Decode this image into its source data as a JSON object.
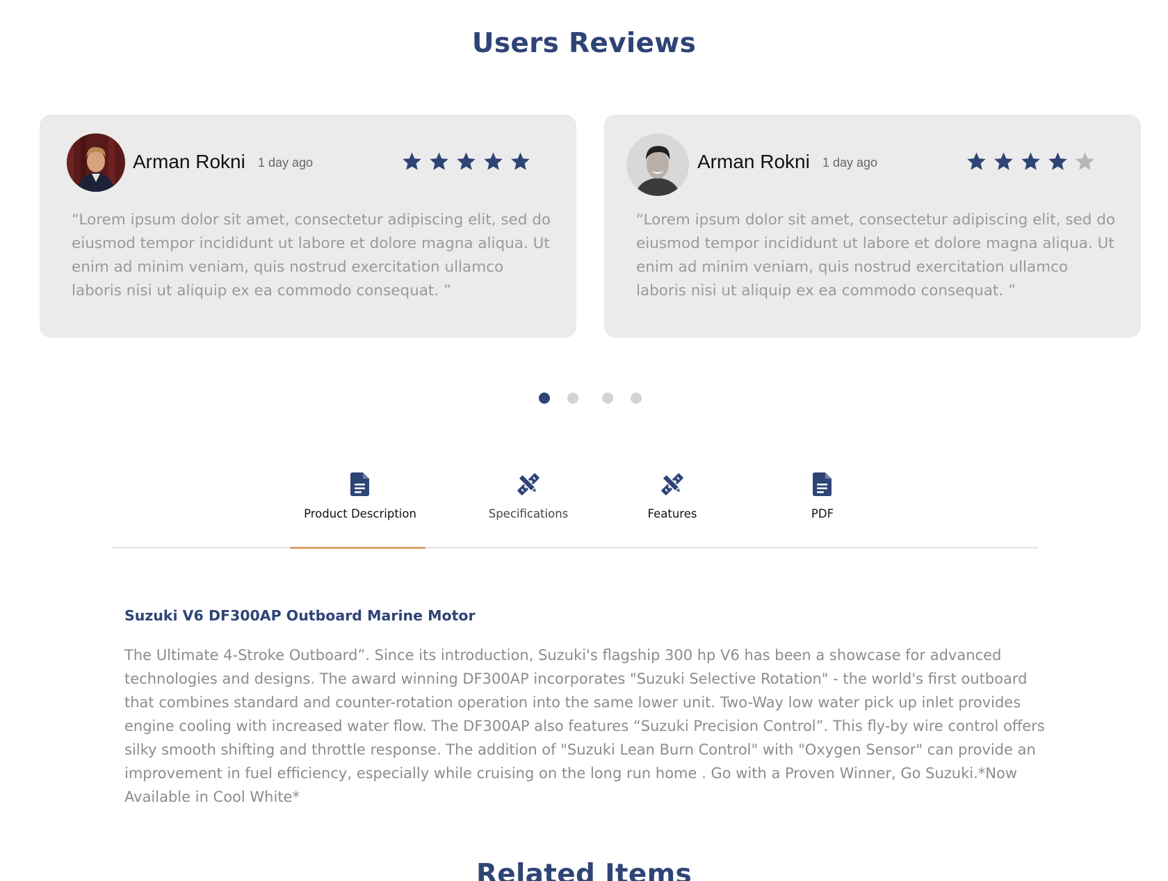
{
  "reviews_section": {
    "title": "Users Reviews"
  },
  "reviews": [
    {
      "name": "Arman Rokni",
      "time": "1 day ago",
      "rating": 5,
      "max_rating": 5,
      "text": "“Lorem ipsum dolor sit amet, consectetur adipiscing elit, sed do eiusmod tempor incididunt ut labore et dolore magna aliqua. Ut enim ad minim veniam, quis nostrud exercitation ullamco laboris nisi ut aliquip ex ea commodo consequat.  ”"
    },
    {
      "name": "Arman Rokni",
      "time": "1 day ago",
      "rating": 4,
      "max_rating": 5,
      "text": "“Lorem ipsum dolor sit amet, consectetur adipiscing elit, sed do eiusmod tempor incididunt ut labore et dolore magna aliqua. Ut enim ad minim veniam, quis nostrud exercitation ullamco laboris nisi ut aliquip ex ea commodo consequat.  ”"
    }
  ],
  "carousel": {
    "page_count": 4,
    "active_page": 1
  },
  "tabs": [
    {
      "label": "Product Description",
      "icon": "document-icon",
      "active": true
    },
    {
      "label": "Specifications",
      "icon": "ruler-pencil-icon",
      "active": false
    },
    {
      "label": "Features",
      "icon": "ruler-pencil-icon",
      "active": false
    },
    {
      "label": "PDF",
      "icon": "document-icon",
      "active": false
    }
  ],
  "product": {
    "title": "Suzuki V6 DF300AP Outboard Marine Motor",
    "description": "The Ultimate 4-Stroke Outboard”. Since its introduction, Suzuki's flagship 300 hp V6 has been a showcase for advanced technologies and designs. The award winning DF300AP incorporates \"Suzuki Selective Rotation\" - the world's first outboard that combines standard and counter-rotation operation into the same lower unit. Two-Way low water pick up inlet provides engine cooling with increased water flow. The DF300AP also features “Suzuki Precision Control”. This fly-by wire control offers silky smooth shifting and throttle response. The addition of \"Suzuki Lean Burn Control\" with \"Oxygen Sensor\" can provide an improvement in fuel efficiency, especially while cruising on the long run home . Go with a Proven Winner, Go Suzuki.*Now Available in Cool White*"
  },
  "related_section": {
    "title": "Related Items"
  },
  "colors": {
    "brand": "#2f4476",
    "star_filled": "#2f4476",
    "star_empty": "#b5b5b5",
    "tab_underline": "#d9a066",
    "card_bg": "#ebebeb"
  }
}
